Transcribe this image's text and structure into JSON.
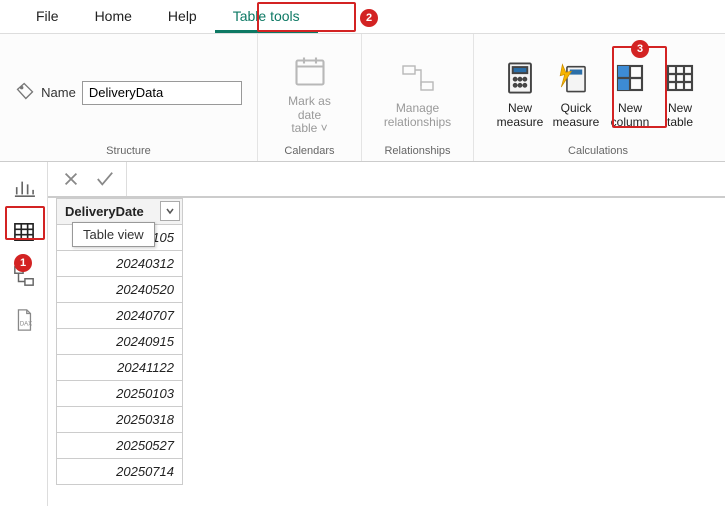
{
  "tabs": {
    "file": "File",
    "home": "Home",
    "help": "Help",
    "table_tools": "Table tools"
  },
  "structure": {
    "name_label": "Name",
    "name_value": "DeliveryData",
    "group_label": "Structure"
  },
  "calendars": {
    "mark_line1": "Mark as date",
    "mark_line2": "table",
    "group_label": "Calendars"
  },
  "relationships": {
    "manage_line1": "Manage",
    "manage_line2": "relationships",
    "group_label": "Relationships"
  },
  "calculations": {
    "new_measure_l1": "New",
    "new_measure_l2": "measure",
    "quick_measure_l1": "Quick",
    "quick_measure_l2": "measure",
    "new_column_l1": "New",
    "new_column_l2": "column",
    "new_table_l1": "New",
    "new_table_l2": "table",
    "group_label": "Calculations"
  },
  "tooltip": {
    "table_view": "Table view"
  },
  "table": {
    "header": "DeliveryDate",
    "rows": [
      "20240105",
      "20240312",
      "20240520",
      "20240707",
      "20240915",
      "20241122",
      "20250103",
      "20250318",
      "20250527",
      "20250714"
    ]
  },
  "callouts": {
    "c1": "1",
    "c2": "2",
    "c3": "3"
  }
}
